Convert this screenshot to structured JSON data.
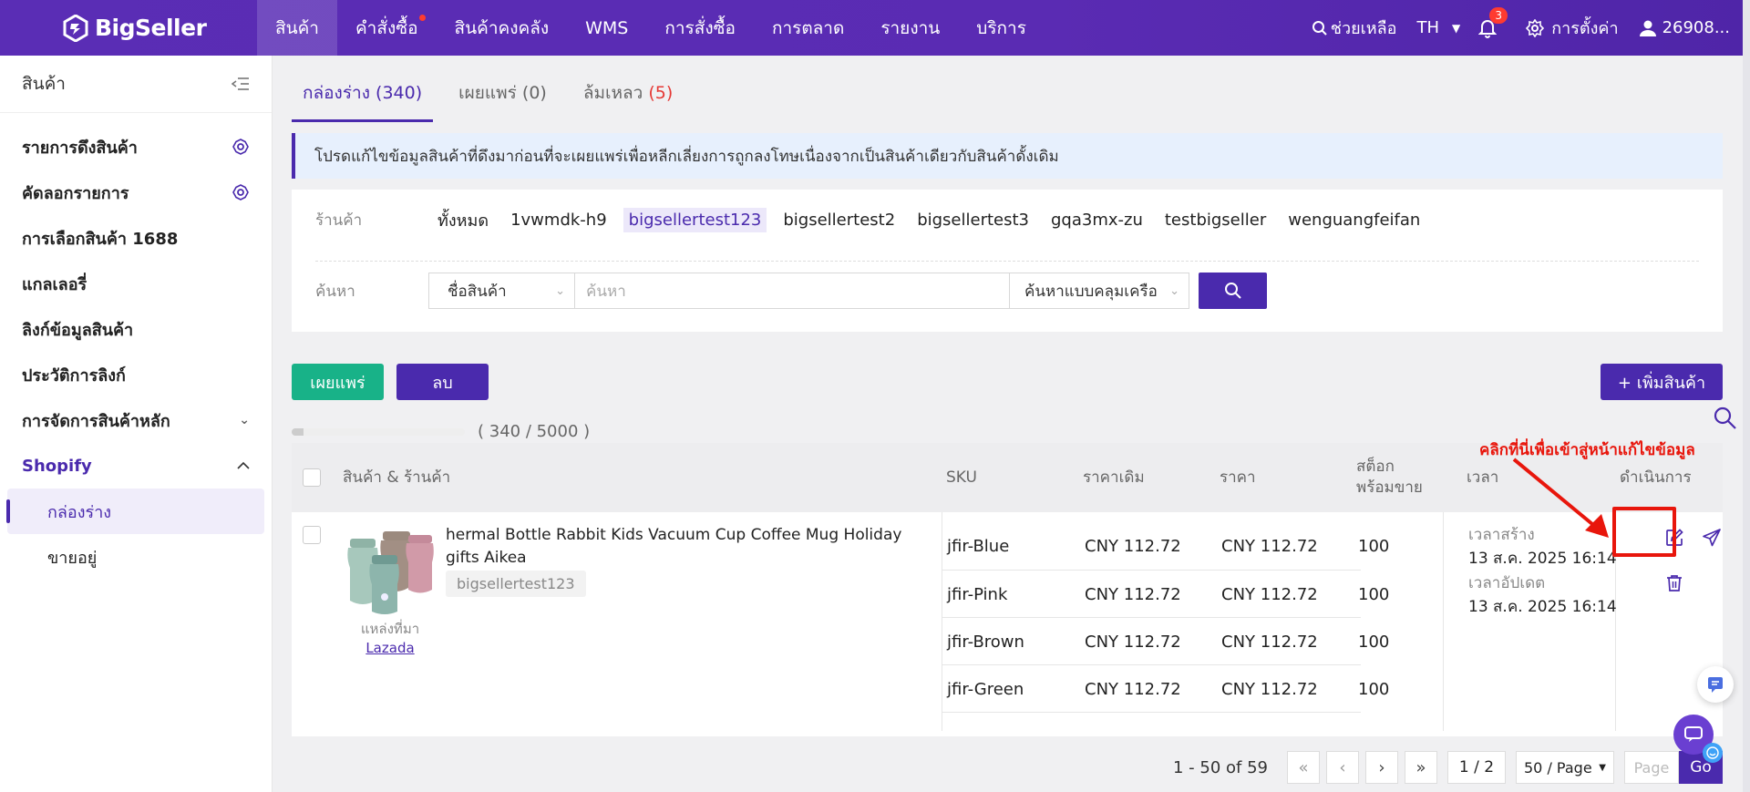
{
  "app": {
    "logo_text": "BigSeller",
    "brand_color": "#5a2db5",
    "accent_green": "#18b288",
    "alert_red": "#e8160c"
  },
  "topnav": {
    "items": [
      {
        "label": "สินค้า",
        "active": true
      },
      {
        "label": "คำสั่งซื้อ",
        "dot": true
      },
      {
        "label": "สินค้าคงคลัง"
      },
      {
        "label": "WMS"
      },
      {
        "label": "การสั่งซื้อ"
      },
      {
        "label": "การตลาด"
      },
      {
        "label": "รายงาน"
      },
      {
        "label": "บริการ"
      }
    ],
    "help": "ช่วยเหลือ",
    "lang": "TH",
    "notif_count": "3",
    "settings": "การตั้งค่า",
    "user": "26908..."
  },
  "sidebar": {
    "title": "สินค้า",
    "items": [
      "รายการดึงสินค้า",
      "คัดลอกรายการ",
      "การเลือกสินค้า 1688",
      "แกลเลอรี่",
      "ลิงก์ข้อมูลสินค้า",
      "ประวัติการลิงก์",
      "การจัดการสินค้าหลัก"
    ],
    "shop": "Shopify",
    "subitems": [
      "กล่องร่าง",
      "ขายอยู่"
    ]
  },
  "tabs": {
    "draft": "กล่องร่าง (340)",
    "published_label": "เผยแพร่",
    "published_count": "(0)",
    "failed_label": "ล้มเหลว",
    "failed_count": "(5)"
  },
  "notice": "โปรดแก้ไขข้อมูลสินค้าที่ดึงมาก่อนที่จะเผยแพร่เพื่อหลีกเลี่ยงการถูกลงโทษเนื่องจากเป็นสินค้าเดียวกับสินค้าดั้งเดิม",
  "filter": {
    "store_label": "ร้านค้า",
    "stores": [
      "ทั้งหมด",
      "1vwmdk-h9",
      "bigsellertest123",
      "bigsellertest2",
      "bigsellertest3",
      "gqa3mx-zu",
      "testbigseller",
      "wenguangfeifan"
    ],
    "selected_store": "bigsellertest123",
    "search_label": "ค้นหา",
    "field_select": "ชื่อสินค้า",
    "placeholder": "ค้นหา",
    "match_select": "ค้นหาแบบคลุมเครือ"
  },
  "actions": {
    "publish": "เผยแพร่",
    "delete": "ลบ",
    "add": "+ เพิ่มสินค้า"
  },
  "quota": {
    "text": "( 340 / 5000 )",
    "fraction": 0.068
  },
  "table": {
    "headers": {
      "product": "สินค้า & ร้านค้า",
      "sku": "SKU",
      "orig_price": "ราคาเดิม",
      "price": "ราคา",
      "stock_1": "สต็อก",
      "stock_2": "พร้อมขาย",
      "time": "เวลา",
      "ops": "ดำเนินการ"
    },
    "product": {
      "title": "hermal Bottle Rabbit Kids Vacuum Cup Coffee Mug Holiday gifts Aikea",
      "store": "bigsellertest123",
      "source_label": "แหล่งที่มา",
      "source": "Lazada",
      "created_label": "เวลาสร้าง",
      "created": "13 ส.ค. 2025 16:14",
      "updated_label": "เวลาอัปเดต",
      "updated": "13 ส.ค. 2025 16:14"
    },
    "variants": [
      {
        "sku": "jfir-Blue",
        "orig": "CNY 112.72",
        "price": "CNY 112.72",
        "stock": "100"
      },
      {
        "sku": "jfir-Pink",
        "orig": "CNY 112.72",
        "price": "CNY 112.72",
        "stock": "100"
      },
      {
        "sku": "jfir-Brown",
        "orig": "CNY 112.72",
        "price": "CNY 112.72",
        "stock": "100"
      },
      {
        "sku": "jfir-Green",
        "orig": "CNY 112.72",
        "price": "CNY 112.72",
        "stock": "100"
      }
    ]
  },
  "annotation": "คลิกที่นี่เพื่อเข้าสู่หน้าแก้ไขข้อมูล",
  "pagination": {
    "summary": "1 - 50 of 59",
    "page": "1 / 2",
    "size": "50 / Page",
    "goto": "Page",
    "go": "Go"
  }
}
